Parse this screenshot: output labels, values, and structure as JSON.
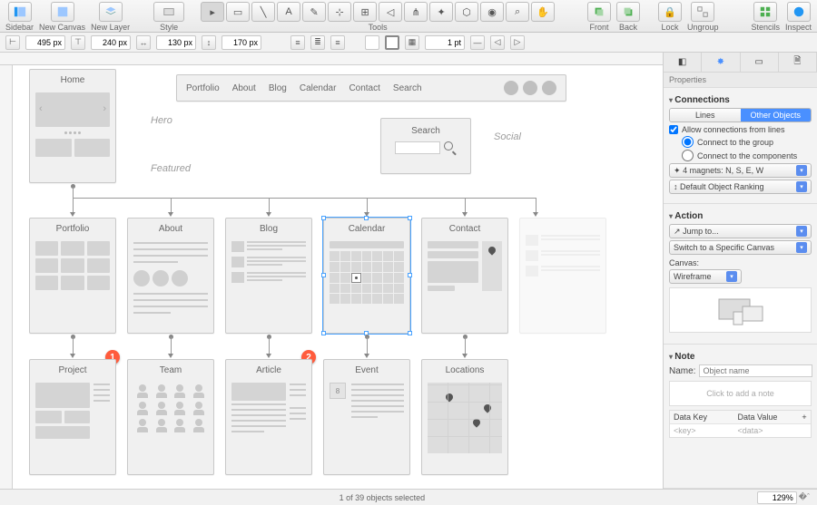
{
  "toolbar": {
    "sidebar": "Sidebar",
    "new_canvas": "New Canvas",
    "new_layer": "New Layer",
    "style": "Style",
    "tools": "Tools",
    "front": "Front",
    "back": "Back",
    "lock": "Lock",
    "ungroup": "Ungroup",
    "stencils": "Stencils",
    "inspect": "Inspect"
  },
  "options": {
    "x": "495 px",
    "y": "240 px",
    "w": "130 px",
    "h": "170 px",
    "stroke": "1 pt"
  },
  "nav": {
    "items": [
      "Portfolio",
      "About",
      "Blog",
      "Calendar",
      "Contact",
      "Search"
    ]
  },
  "cards": {
    "home": "Home",
    "search": "Search",
    "portfolio": "Portfolio",
    "about": "About",
    "blog": "Blog",
    "calendar": "Calendar",
    "contact": "Contact",
    "project": "Project",
    "team": "Team",
    "article": "Article",
    "event": "Event",
    "locations": "Locations"
  },
  "annots": {
    "hero": "Hero",
    "featured": "Featured",
    "social": "Social"
  },
  "bubbles": {
    "b1": "1",
    "b2": "2"
  },
  "inspector": {
    "properties": "Properties",
    "connections": "Connections",
    "seg_lines": "Lines",
    "seg_other": "Other Objects",
    "allow": "Allow connections from lines",
    "connect_group": "Connect to the group",
    "connect_components": "Connect to the components",
    "magnets": "4 magnets: N, S, E, W",
    "ranking": "Default Object Ranking",
    "action": "Action",
    "jump": "Jump to...",
    "switch": "Switch to a Specific Canvas",
    "canvas_label": "Canvas:",
    "canvas_value": "Wireframe",
    "note": "Note",
    "name_label": "Name:",
    "name_placeholder": "Object name",
    "click_note": "Click to add a note",
    "data_key": "Data Key",
    "data_value": "Data Value",
    "key_ph": "<key>",
    "val_ph": "<data>"
  },
  "status": {
    "selection": "1 of 39 objects selected",
    "zoom": "129%"
  },
  "event": {
    "day": "8"
  }
}
